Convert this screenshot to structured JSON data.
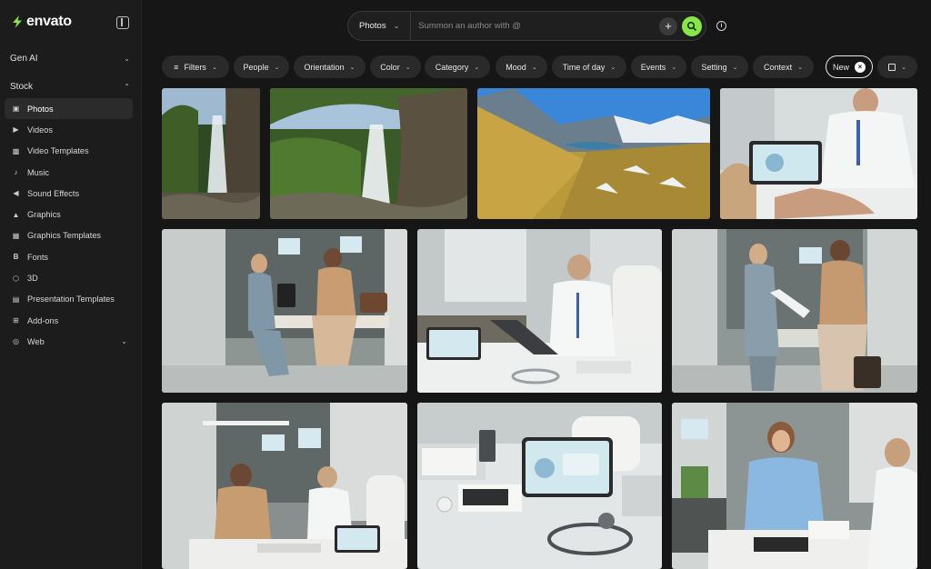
{
  "app": {
    "logo_text": "envato",
    "accent": "#87e64b"
  },
  "sidebar": {
    "sections": {
      "gen_ai": "Gen AI",
      "stock": "Stock"
    },
    "items": [
      {
        "label": "Photos",
        "icon": "image-icon",
        "active": true
      },
      {
        "label": "Videos",
        "icon": "video-icon"
      },
      {
        "label": "Video Templates",
        "icon": "video-template-icon"
      },
      {
        "label": "Music",
        "icon": "music-note-icon"
      },
      {
        "label": "Sound Effects",
        "icon": "sound-icon"
      },
      {
        "label": "Graphics",
        "icon": "mountain-icon"
      },
      {
        "label": "Graphics Templates",
        "icon": "template-icon"
      },
      {
        "label": "Fonts",
        "icon": "font-icon"
      },
      {
        "label": "3D",
        "icon": "cube-icon"
      },
      {
        "label": "Presentation Templates",
        "icon": "presentation-icon"
      },
      {
        "label": "Add-ons",
        "icon": "add-on-icon"
      },
      {
        "label": "Web",
        "icon": "globe-icon"
      }
    ]
  },
  "search": {
    "type_label": "Photos",
    "placeholder": "Summon an author with @"
  },
  "filters": {
    "filters_label": "Filters",
    "chips": [
      "People",
      "Orientation",
      "Color",
      "Category",
      "Mood",
      "Time of day",
      "Events",
      "Setting",
      "Context"
    ],
    "new_label": "New"
  }
}
